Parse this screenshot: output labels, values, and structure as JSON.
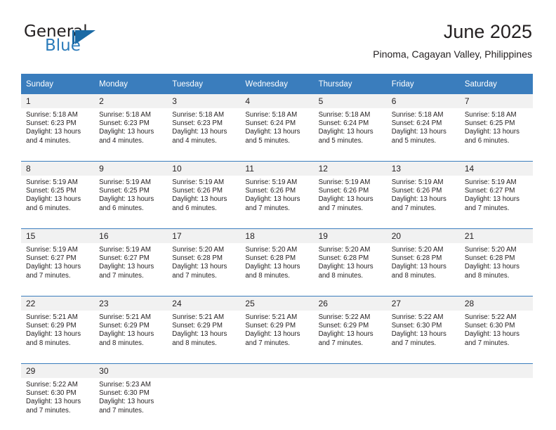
{
  "brand": {
    "name_part1": "General",
    "name_part2": "Blue",
    "logo_icon": "triangle-flag-mark",
    "accent_color": "#2b7bba"
  },
  "header": {
    "title": "June 2025",
    "subtitle": "Pinoma, Cagayan Valley, Philippines"
  },
  "calendar": {
    "header_bg": "#3a7dbd",
    "daynum_bg": "#f1f1f1",
    "weekday_headers": [
      "Sunday",
      "Monday",
      "Tuesday",
      "Wednesday",
      "Thursday",
      "Friday",
      "Saturday"
    ],
    "weeks": [
      [
        {
          "day": "1",
          "sunrise": "Sunrise: 5:18 AM",
          "sunset": "Sunset: 6:23 PM",
          "daylight": "Daylight: 13 hours and 4 minutes."
        },
        {
          "day": "2",
          "sunrise": "Sunrise: 5:18 AM",
          "sunset": "Sunset: 6:23 PM",
          "daylight": "Daylight: 13 hours and 4 minutes."
        },
        {
          "day": "3",
          "sunrise": "Sunrise: 5:18 AM",
          "sunset": "Sunset: 6:23 PM",
          "daylight": "Daylight: 13 hours and 4 minutes."
        },
        {
          "day": "4",
          "sunrise": "Sunrise: 5:18 AM",
          "sunset": "Sunset: 6:24 PM",
          "daylight": "Daylight: 13 hours and 5 minutes."
        },
        {
          "day": "5",
          "sunrise": "Sunrise: 5:18 AM",
          "sunset": "Sunset: 6:24 PM",
          "daylight": "Daylight: 13 hours and 5 minutes."
        },
        {
          "day": "6",
          "sunrise": "Sunrise: 5:18 AM",
          "sunset": "Sunset: 6:24 PM",
          "daylight": "Daylight: 13 hours and 5 minutes."
        },
        {
          "day": "7",
          "sunrise": "Sunrise: 5:18 AM",
          "sunset": "Sunset: 6:25 PM",
          "daylight": "Daylight: 13 hours and 6 minutes."
        }
      ],
      [
        {
          "day": "8",
          "sunrise": "Sunrise: 5:19 AM",
          "sunset": "Sunset: 6:25 PM",
          "daylight": "Daylight: 13 hours and 6 minutes."
        },
        {
          "day": "9",
          "sunrise": "Sunrise: 5:19 AM",
          "sunset": "Sunset: 6:25 PM",
          "daylight": "Daylight: 13 hours and 6 minutes."
        },
        {
          "day": "10",
          "sunrise": "Sunrise: 5:19 AM",
          "sunset": "Sunset: 6:26 PM",
          "daylight": "Daylight: 13 hours and 6 minutes."
        },
        {
          "day": "11",
          "sunrise": "Sunrise: 5:19 AM",
          "sunset": "Sunset: 6:26 PM",
          "daylight": "Daylight: 13 hours and 7 minutes."
        },
        {
          "day": "12",
          "sunrise": "Sunrise: 5:19 AM",
          "sunset": "Sunset: 6:26 PM",
          "daylight": "Daylight: 13 hours and 7 minutes."
        },
        {
          "day": "13",
          "sunrise": "Sunrise: 5:19 AM",
          "sunset": "Sunset: 6:26 PM",
          "daylight": "Daylight: 13 hours and 7 minutes."
        },
        {
          "day": "14",
          "sunrise": "Sunrise: 5:19 AM",
          "sunset": "Sunset: 6:27 PM",
          "daylight": "Daylight: 13 hours and 7 minutes."
        }
      ],
      [
        {
          "day": "15",
          "sunrise": "Sunrise: 5:19 AM",
          "sunset": "Sunset: 6:27 PM",
          "daylight": "Daylight: 13 hours and 7 minutes."
        },
        {
          "day": "16",
          "sunrise": "Sunrise: 5:19 AM",
          "sunset": "Sunset: 6:27 PM",
          "daylight": "Daylight: 13 hours and 7 minutes."
        },
        {
          "day": "17",
          "sunrise": "Sunrise: 5:20 AM",
          "sunset": "Sunset: 6:28 PM",
          "daylight": "Daylight: 13 hours and 7 minutes."
        },
        {
          "day": "18",
          "sunrise": "Sunrise: 5:20 AM",
          "sunset": "Sunset: 6:28 PM",
          "daylight": "Daylight: 13 hours and 8 minutes."
        },
        {
          "day": "19",
          "sunrise": "Sunrise: 5:20 AM",
          "sunset": "Sunset: 6:28 PM",
          "daylight": "Daylight: 13 hours and 8 minutes."
        },
        {
          "day": "20",
          "sunrise": "Sunrise: 5:20 AM",
          "sunset": "Sunset: 6:28 PM",
          "daylight": "Daylight: 13 hours and 8 minutes."
        },
        {
          "day": "21",
          "sunrise": "Sunrise: 5:20 AM",
          "sunset": "Sunset: 6:28 PM",
          "daylight": "Daylight: 13 hours and 8 minutes."
        }
      ],
      [
        {
          "day": "22",
          "sunrise": "Sunrise: 5:21 AM",
          "sunset": "Sunset: 6:29 PM",
          "daylight": "Daylight: 13 hours and 8 minutes."
        },
        {
          "day": "23",
          "sunrise": "Sunrise: 5:21 AM",
          "sunset": "Sunset: 6:29 PM",
          "daylight": "Daylight: 13 hours and 8 minutes."
        },
        {
          "day": "24",
          "sunrise": "Sunrise: 5:21 AM",
          "sunset": "Sunset: 6:29 PM",
          "daylight": "Daylight: 13 hours and 8 minutes."
        },
        {
          "day": "25",
          "sunrise": "Sunrise: 5:21 AM",
          "sunset": "Sunset: 6:29 PM",
          "daylight": "Daylight: 13 hours and 7 minutes."
        },
        {
          "day": "26",
          "sunrise": "Sunrise: 5:22 AM",
          "sunset": "Sunset: 6:29 PM",
          "daylight": "Daylight: 13 hours and 7 minutes."
        },
        {
          "day": "27",
          "sunrise": "Sunrise: 5:22 AM",
          "sunset": "Sunset: 6:30 PM",
          "daylight": "Daylight: 13 hours and 7 minutes."
        },
        {
          "day": "28",
          "sunrise": "Sunrise: 5:22 AM",
          "sunset": "Sunset: 6:30 PM",
          "daylight": "Daylight: 13 hours and 7 minutes."
        }
      ],
      [
        {
          "day": "29",
          "sunrise": "Sunrise: 5:22 AM",
          "sunset": "Sunset: 6:30 PM",
          "daylight": "Daylight: 13 hours and 7 minutes."
        },
        {
          "day": "30",
          "sunrise": "Sunrise: 5:23 AM",
          "sunset": "Sunset: 6:30 PM",
          "daylight": "Daylight: 13 hours and 7 minutes."
        },
        {
          "day": "",
          "sunrise": "",
          "sunset": "",
          "daylight": ""
        },
        {
          "day": "",
          "sunrise": "",
          "sunset": "",
          "daylight": ""
        },
        {
          "day": "",
          "sunrise": "",
          "sunset": "",
          "daylight": ""
        },
        {
          "day": "",
          "sunrise": "",
          "sunset": "",
          "daylight": ""
        },
        {
          "day": "",
          "sunrise": "",
          "sunset": "",
          "daylight": ""
        }
      ]
    ]
  }
}
